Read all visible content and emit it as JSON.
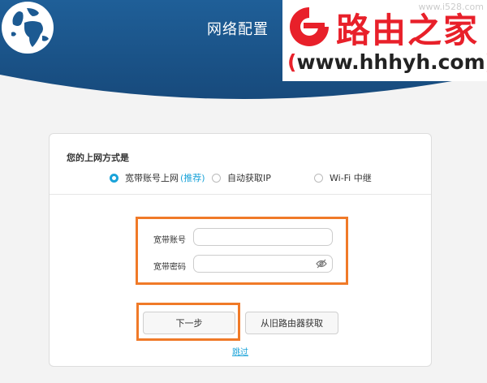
{
  "header": {
    "title": "网络配置"
  },
  "watermark": {
    "small": "www.i528.com",
    "name": "路由之家",
    "url_open": "(",
    "url": "www.hhhyh.com",
    "url_close": ")"
  },
  "form": {
    "section_title": "您的上网方式是",
    "options": [
      {
        "label": "宽带账号上网",
        "tag": "(推荐)",
        "selected": true
      },
      {
        "label": "自动获取IP",
        "selected": false
      },
      {
        "label": "Wi-Fi 中继",
        "selected": false
      }
    ],
    "account_label": "宽带账号",
    "account_value": "",
    "password_label": "宽带密码",
    "password_value": "",
    "next_label": "下一步",
    "fetch_label": "从旧路由器获取",
    "skip_label": "跳过"
  },
  "colors": {
    "accent": "#1aa3d9",
    "highlight": "#f07a28",
    "header": "#1c5a92",
    "brand_red": "#e8202a"
  }
}
